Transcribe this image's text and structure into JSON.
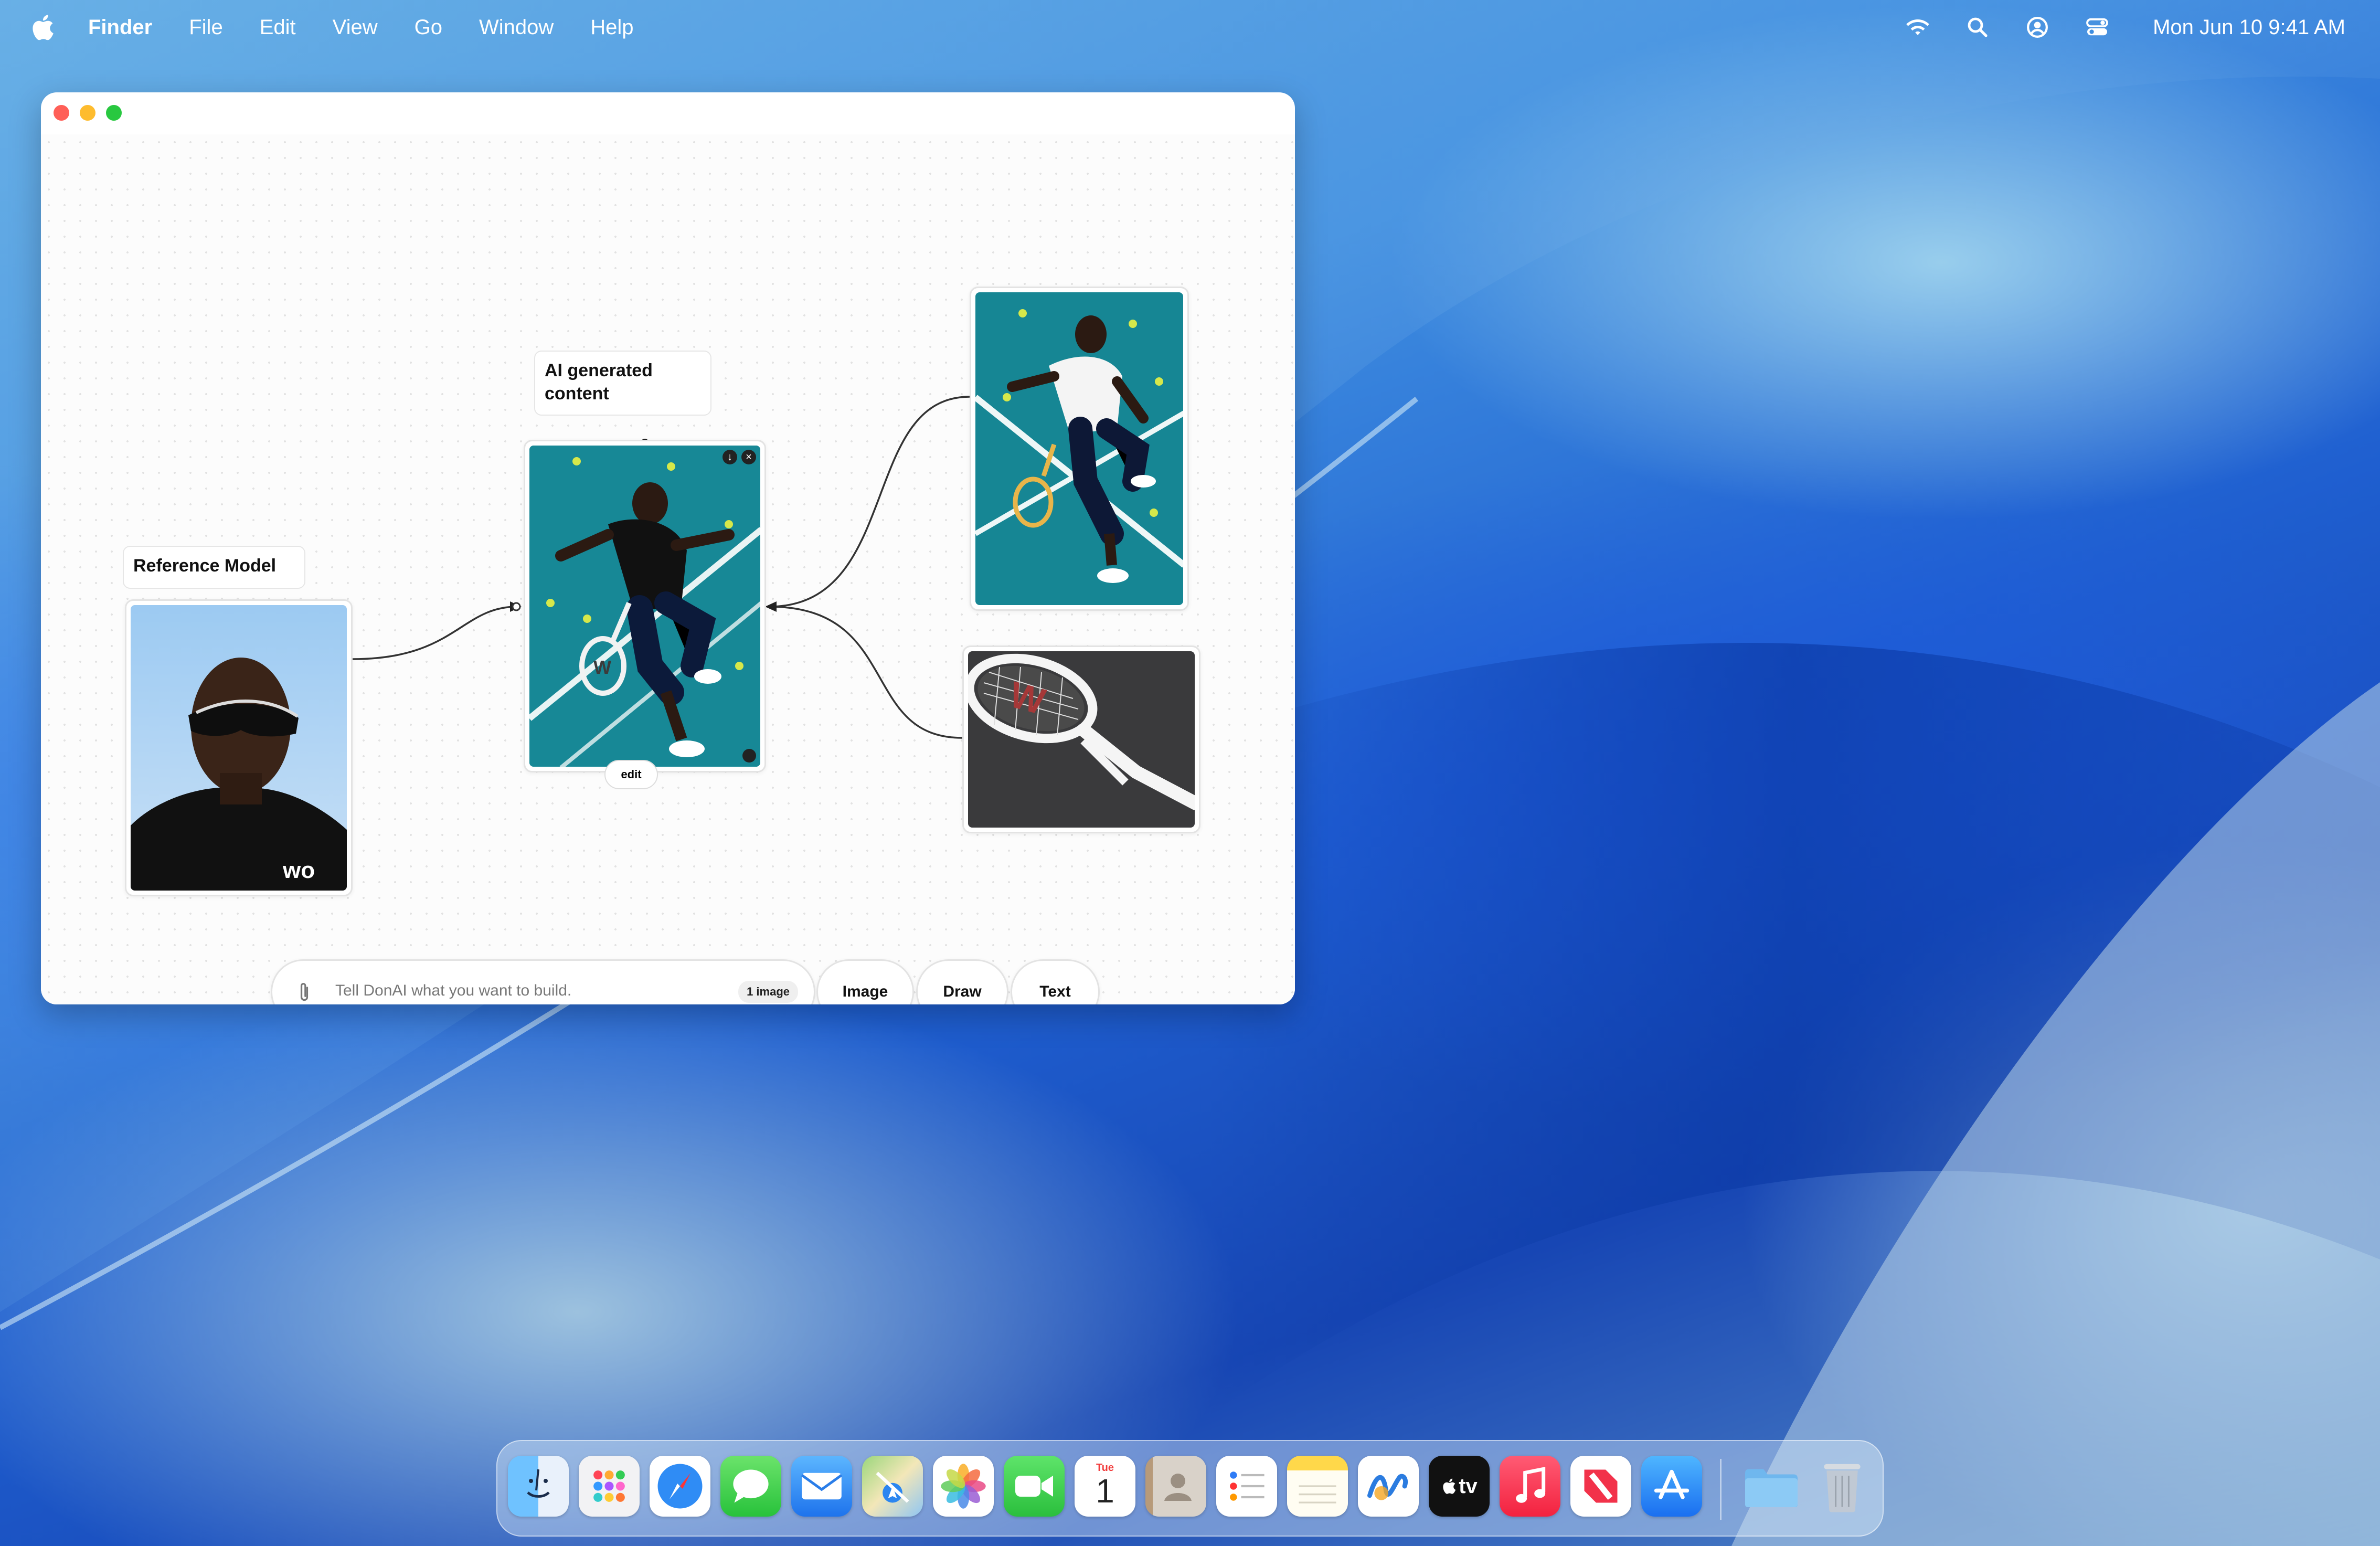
{
  "menubar": {
    "apple_icon": "apple-logo-icon",
    "items": [
      "Finder",
      "File",
      "Edit",
      "View",
      "Go",
      "Window",
      "Help"
    ],
    "status_icons": [
      "wifi-icon",
      "search-icon",
      "user-account-icon",
      "control-center-icon"
    ],
    "clock": "Mon Jun 10  9:41 AM"
  },
  "window": {
    "labels": {
      "reference": "Reference Model",
      "ai_generated": "AI generated content"
    },
    "edit_button": "edit",
    "prompt": {
      "placeholder": "Tell DonAI what you want to build.",
      "attachment_badge": "1 image"
    },
    "tools": [
      "Image",
      "Draw",
      "Text"
    ]
  },
  "dock": {
    "apps": [
      "Finder",
      "Launchpad",
      "Safari",
      "Messages",
      "Mail",
      "Maps",
      "Photos",
      "FaceTime",
      "Calendar",
      "Contacts",
      "Reminders",
      "Notes",
      "Freeform",
      "TV",
      "Music",
      "News",
      "App Store"
    ],
    "calendar": {
      "month": "Tue",
      "day": "1"
    },
    "tv_label": "tv",
    "extras": [
      "Downloads folder",
      "Trash"
    ]
  }
}
